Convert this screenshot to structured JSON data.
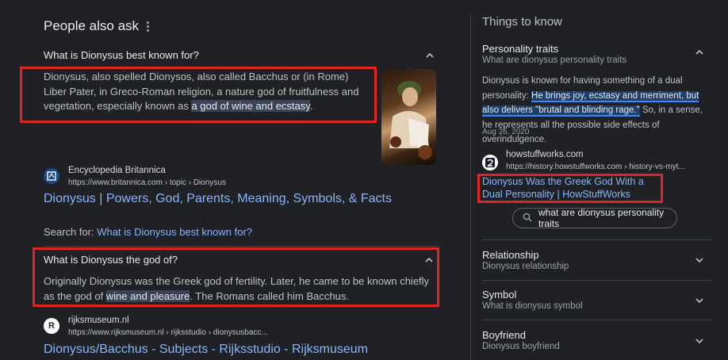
{
  "paa": {
    "title": "People also ask",
    "q1": {
      "question": "What is Dionysus best known for?",
      "answer_before": "Dionysus, also spelled Dionysos, also called Bacchus or (in Rome) Liber Pater, in Greco-Roman religion, a nature god of fruitfulness and vegetation, especially known as ",
      "answer_highlight": "a god of wine and ecstasy",
      "answer_after": ".",
      "source_name": "Encyclopedia Britannica",
      "source_url": "https://www.britannica.com › topic › Dionysus",
      "link": "Dionysus | Powers, God, Parents, Meaning, Symbols, & Facts",
      "search_prefix": "Search for: ",
      "search_link": "What is Dionysus best known for?"
    },
    "q2": {
      "question": "What is Dionysus the god of?",
      "answer_before": "Originally Dionysus was the Greek god of fertility. Later, he came to be known chiefly as the god of ",
      "answer_highlight": "wine and pleasure",
      "answer_after": ". The Romans called him Bacchus.",
      "favicon_letter": "R",
      "source_name": "rijksmuseum.nl",
      "source_url": "https://www.rijksmuseum.nl › rijksstudio › dionysusbacc...",
      "link": "Dionysus/Bacchus - Subjects - Rijksstudio - Rijksmuseum"
    }
  },
  "ttk": {
    "title": "Things to know",
    "personality": {
      "heading": "Personality traits",
      "sub": "What are dionysus personality traits",
      "body_1": "Dionysus is known for having something of a dual personality: ",
      "hl_1": "He brings joy, ecstasy and merriment, but also delivers \"brutal and blinding rage.\"",
      "body_2": " So, in a sense, he represents all the possible side effects of overindulgence.",
      "date": "Aug 26, 2020",
      "source_name": "howstuffworks.com",
      "source_url": "https://history.howstuffworks.com › history-vs-myt...",
      "link": "Dionysus Was the Greek God With a Dual Personality | HowStuffWorks",
      "chip": "what are dionysus personality traits"
    },
    "items": [
      {
        "heading": "Relationship",
        "sub": "Dionysus relationship"
      },
      {
        "heading": "Symbol",
        "sub": "What is dionysus symbol"
      },
      {
        "heading": "Boyfriend",
        "sub": "Dionysus boyfriend"
      }
    ]
  },
  "colors": {
    "background": "#202124",
    "link": "#8ab4f8",
    "highlight_box": "#e02424"
  }
}
